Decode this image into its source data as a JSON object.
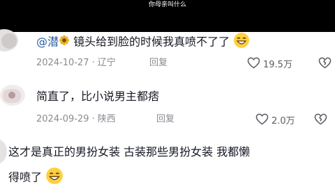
{
  "video": {
    "caption": "你母亲叫什么"
  },
  "comments": [
    {
      "mention": "@潜",
      "text": " 镜头给到脸的时候我真喷不了了",
      "date": "2024-10-27",
      "location": "辽宁",
      "reply_label": "回复",
      "likes": "19.5万",
      "icons": {
        "mention_badge": "sunflower-icon",
        "emoji": "grin-emoji-icon"
      }
    },
    {
      "text": "简直了，比小说男主都痞",
      "date": "2024-09-29",
      "location": "陕西",
      "reply_label": "回复",
      "likes": "2.0万"
    },
    {
      "text_line1": "这才是真正的男扮女装 古装那些男扮女装 我都懒",
      "text_line2": "得喷了",
      "icons": {
        "emoji": "grin-emoji-icon"
      }
    }
  ],
  "colors": {
    "topbar": "#000000",
    "meta": "#8a8b91",
    "accent_dislike": "#c0c0c5"
  }
}
